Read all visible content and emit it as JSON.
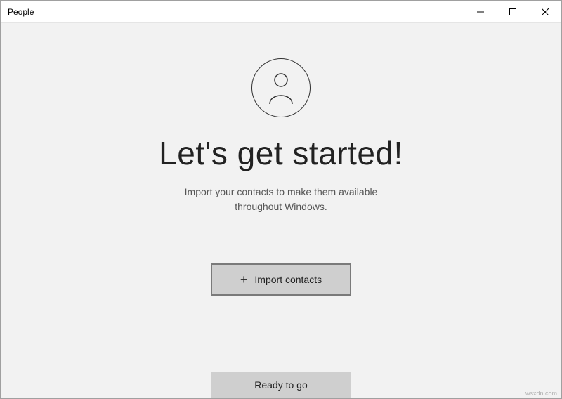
{
  "window": {
    "title": "People"
  },
  "content": {
    "heading": "Let's get started!",
    "subtext_line1": "Import your contacts to make them available",
    "subtext_line2": "throughout Windows."
  },
  "buttons": {
    "import_label": "Import contacts",
    "ready_label": "Ready to go"
  },
  "watermark": "wsxdn.com"
}
